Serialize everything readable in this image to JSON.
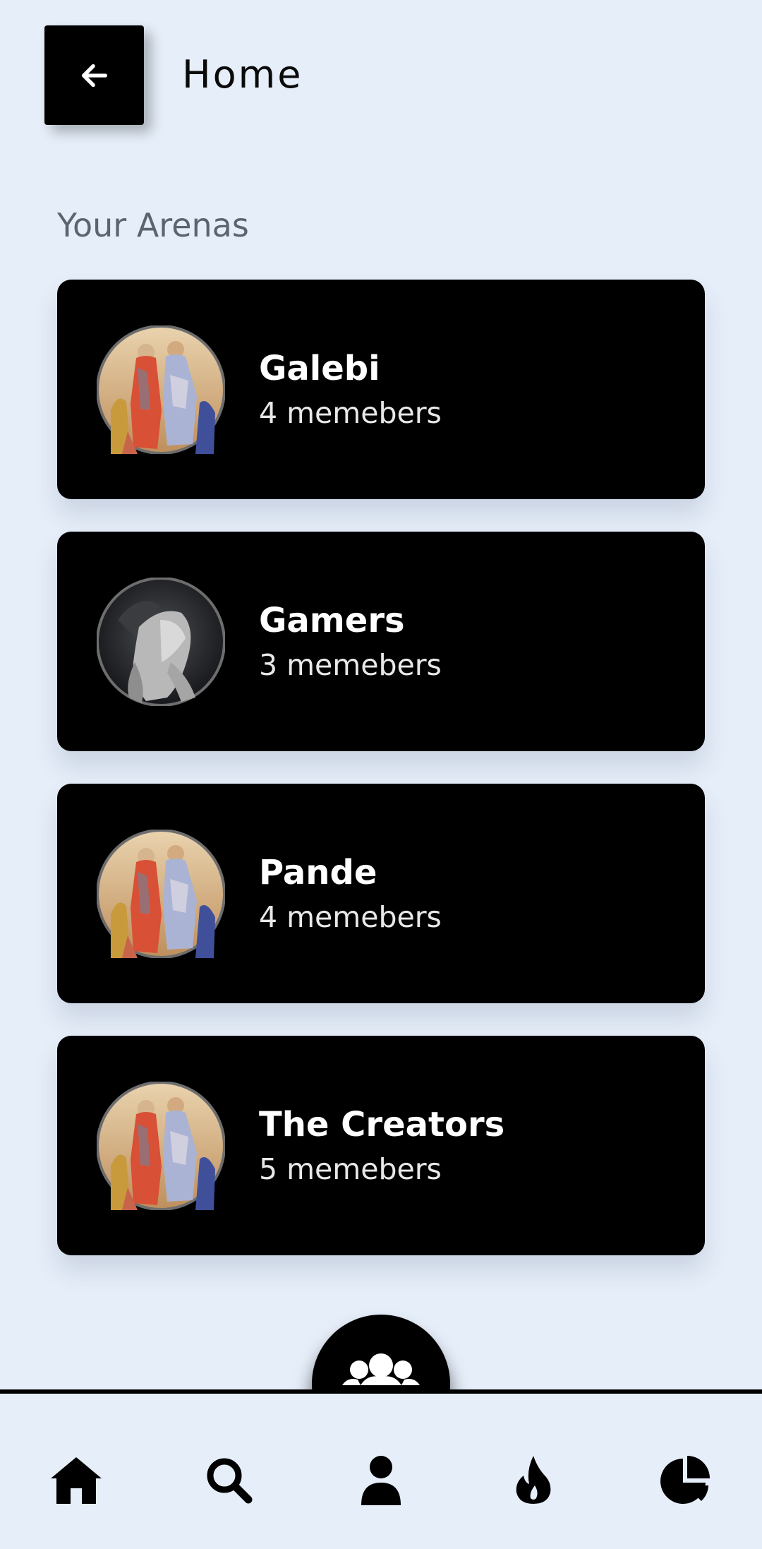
{
  "header": {
    "title": "Home"
  },
  "section": {
    "title": "Your Arenas"
  },
  "arenas": [
    {
      "name": "Galebi",
      "members": "4 memebers",
      "avatar": "school-of-athens-painting"
    },
    {
      "name": "Gamers",
      "members": "3 memebers",
      "avatar": "marble-sculpture"
    },
    {
      "name": "Pande",
      "members": "4 memebers",
      "avatar": "school-of-athens-painting"
    },
    {
      "name": "The Creators",
      "members": "5 memebers",
      "avatar": "school-of-athens-painting"
    }
  ],
  "fab": {
    "icon": "group-icon"
  },
  "bottom_nav": [
    {
      "icon": "home-icon"
    },
    {
      "icon": "search-icon"
    },
    {
      "icon": "user-icon"
    },
    {
      "icon": "fire-icon"
    },
    {
      "icon": "pie-chart-icon"
    }
  ],
  "colors": {
    "background": "#e6eef9",
    "card": "#000000",
    "text_dark": "#0a0a0a",
    "section_title": "#5d6470"
  }
}
